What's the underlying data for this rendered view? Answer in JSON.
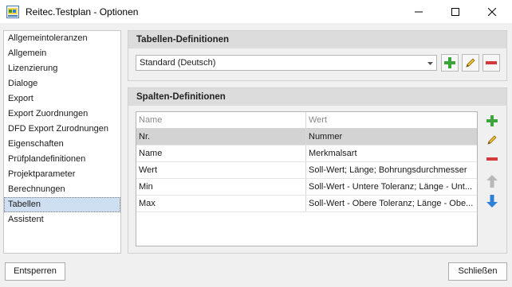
{
  "window": {
    "title": "Reitec.Testplan - Optionen"
  },
  "sidebar": {
    "items": [
      {
        "label": "Allgemeintoleranzen"
      },
      {
        "label": "Allgemein"
      },
      {
        "label": "Lizenzierung"
      },
      {
        "label": "Dialoge"
      },
      {
        "label": "Export"
      },
      {
        "label": "Export Zuordnungen"
      },
      {
        "label": "DFD Export Zurodnungen"
      },
      {
        "label": "Eigenschaften"
      },
      {
        "label": "Prüfplandefinitionen"
      },
      {
        "label": "Projektparameter"
      },
      {
        "label": "Berechnungen"
      },
      {
        "label": "Tabellen"
      },
      {
        "label": "Assistent"
      }
    ],
    "selected": "Tabellen"
  },
  "tabellen": {
    "header": "Tabellen-Definitionen",
    "selected_value": "Standard (Deutsch)"
  },
  "spalten": {
    "header": "Spalten-Definitionen",
    "columns": [
      "Name",
      "Wert"
    ],
    "rows": [
      {
        "name": "Nr.",
        "wert": "Nummer"
      },
      {
        "name": "Name",
        "wert": "Merkmalsart"
      },
      {
        "name": "Wert",
        "wert": "Soll-Wert; Länge; Bohrungsdurchmesser"
      },
      {
        "name": "Min",
        "wert": "Soll-Wert - Untere Toleranz; Länge - Unt..."
      },
      {
        "name": "Max",
        "wert": "Soll-Wert - Obere Toleranz; Länge - Obe..."
      }
    ],
    "selected_row": 0
  },
  "footer": {
    "left_button": "Entsperren",
    "right_button": "Schließen"
  },
  "colors": {
    "add_green": "#3aa53a",
    "delete_red": "#d33a3a",
    "edit_yellow": "#f0c030",
    "move_down_blue": "#2f7fd6",
    "move_up_disabled": "#b8b8b8",
    "selection_nav": "#cfdff2",
    "header_bg": "#dcdcdc"
  },
  "icons": {
    "add": "plus-icon",
    "edit": "pencil-icon",
    "delete": "minus-icon",
    "up": "arrow-up-icon",
    "down": "arrow-down-icon"
  }
}
